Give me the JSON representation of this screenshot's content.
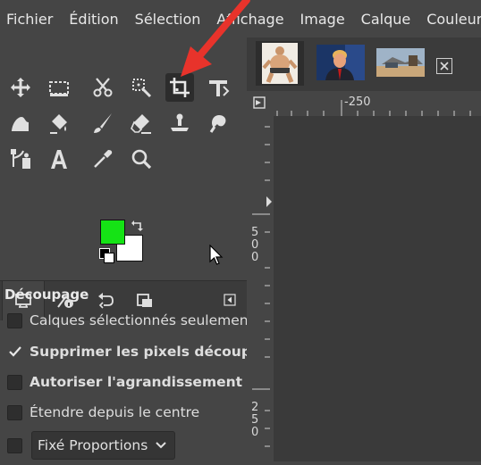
{
  "menu": [
    "Fichier",
    "Édition",
    "Sélection",
    "Affichage",
    "Image",
    "Calque",
    "Couleur"
  ],
  "colors": {
    "foreground": "#15e315",
    "background": "#ffffff",
    "annotation_arrow": "#e8332b"
  },
  "tools": [
    {
      "name": "move-icon"
    },
    {
      "name": "rect-select-icon"
    },
    {
      "name": "scissors-icon"
    },
    {
      "name": "fuzzy-select-icon"
    },
    {
      "name": "crop-icon",
      "active": true
    },
    {
      "name": "unified-transform-icon"
    },
    {
      "name": "warp-icon"
    },
    {
      "name": "bucket-fill-icon"
    },
    {
      "name": "paintbrush-icon"
    },
    {
      "name": "eraser-icon"
    },
    {
      "name": "clone-icon"
    },
    {
      "name": "smudge-icon"
    },
    {
      "name": "paths-icon"
    },
    {
      "name": "text-icon"
    },
    {
      "name": "color-picker-icon"
    },
    {
      "name": "zoom-icon"
    }
  ],
  "dock_tabs": [
    "tool-options-icon",
    "device-status-icon",
    "undo-history-icon",
    "images-icon"
  ],
  "tool_options": {
    "title": "Découpage",
    "options": [
      {
        "label": "Calques sélectionnés seulemen",
        "checked": false,
        "bold": false
      },
      {
        "label": "Supprimer les pixels découpé",
        "checked": true,
        "bold": true
      },
      {
        "label": "Autoriser l'agrandissement",
        "checked": false,
        "bold": true
      },
      {
        "label": "Étendre depuis le centre",
        "checked": false,
        "bold": false
      }
    ],
    "fixed": {
      "label": "Fixé Proportions",
      "checked": false
    }
  },
  "ruler": {
    "h_label": "-250",
    "v_label_1": "50",
    "v_label_2": "0",
    "v_label_3": "25",
    "v_label_4": "0"
  }
}
